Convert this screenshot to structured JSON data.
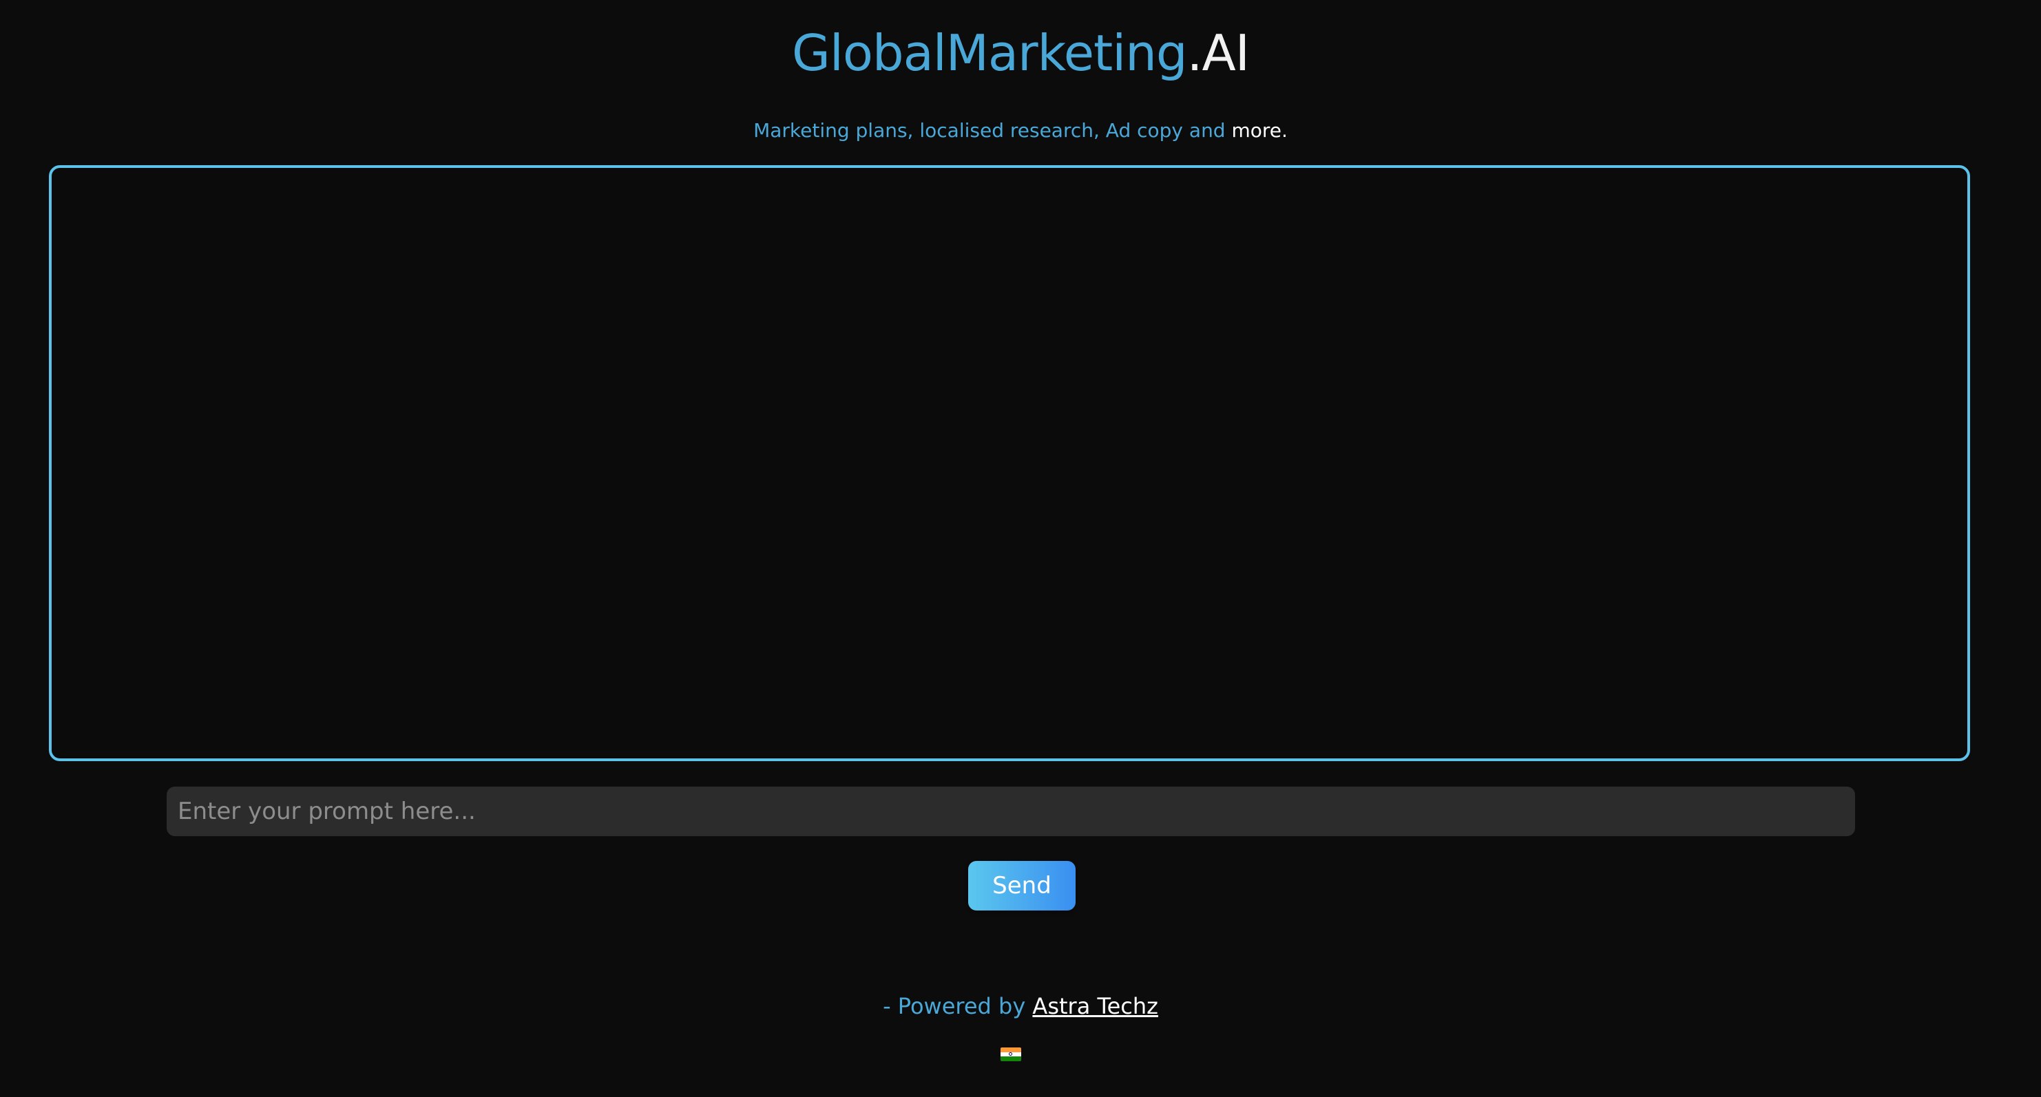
{
  "header": {
    "brand": "GlobalMarketing",
    "suffix": ".AI",
    "subtitle_main": "Marketing plans, localised research, Ad copy and ",
    "subtitle_highlight": "more."
  },
  "chat": {
    "output": ""
  },
  "prompt": {
    "placeholder": "Enter your prompt here...",
    "value": ""
  },
  "send_button": {
    "label": "Send"
  },
  "footer": {
    "prefix": "- Powered by ",
    "link_label": "Astra Techz",
    "flag_icon": "india-flag-icon"
  },
  "colors": {
    "accent": "#4aa8d8",
    "border": "#5cc2ea",
    "background": "#0c0c0d",
    "input_bg": "#2c2c2d"
  }
}
